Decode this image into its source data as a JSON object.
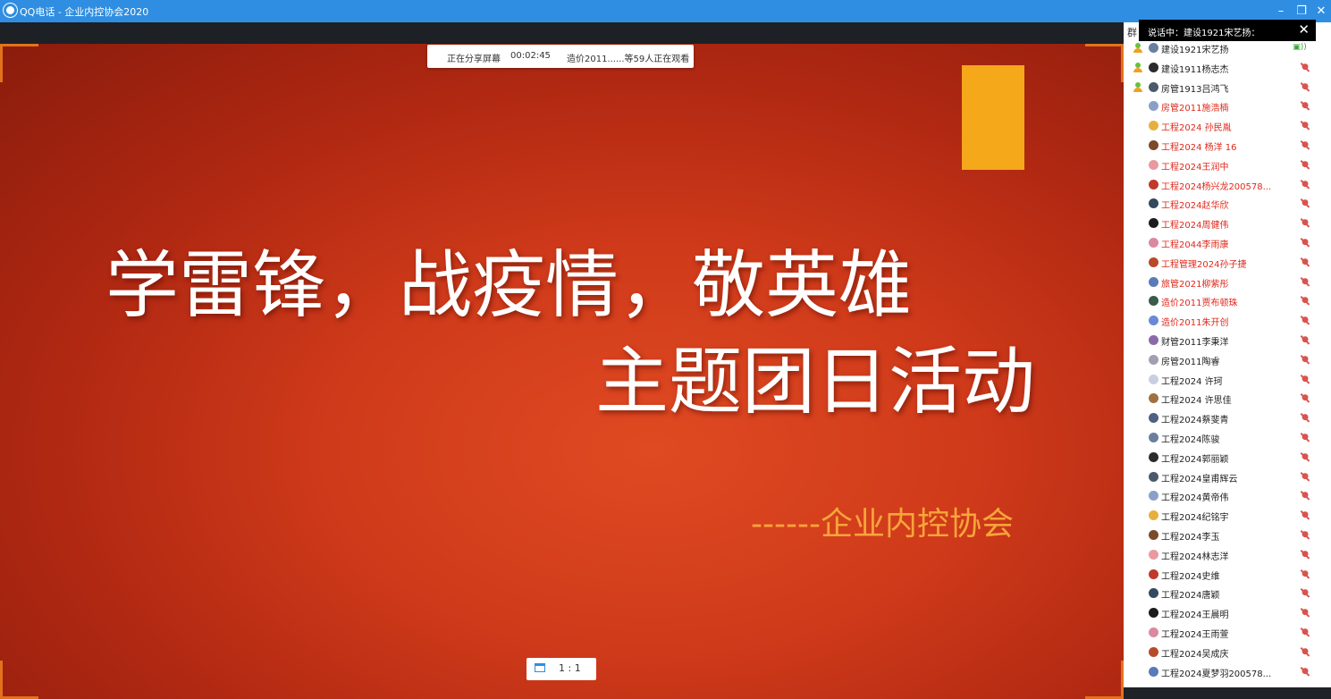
{
  "window": {
    "title": "QQ电话 - 企业内控协会2020",
    "buttons": {
      "minimize": "–",
      "restore": "❐",
      "close": "✕"
    }
  },
  "share_bar": {
    "status": "正在分享屏幕",
    "timer": "00:02:45",
    "viewers": "造价2011......等59人正在观看"
  },
  "slide": {
    "title_line1": "学雷锋，战疫情，敬英雄",
    "title_line2": "主题团日活动",
    "subtitle": "------企业内控协会",
    "colors": {
      "background": "#cf3a1a",
      "accent_bar": "#f4a81a",
      "subtitle": "#f8a53a"
    }
  },
  "ratio_button": {
    "label": "1 : 1"
  },
  "sidebar": {
    "tab_stub": "群",
    "speaking_tip": "说话中：建设1921宋艺扬：",
    "speaking_close": "✕",
    "members": [
      {
        "name": "建设1921宋艺扬",
        "host": true,
        "red": false,
        "speaking": true
      },
      {
        "name": "建设1911杨志杰",
        "host": true,
        "red": false
      },
      {
        "name": "房管1913吕鸿飞",
        "host": true,
        "red": false
      },
      {
        "name": "房管2011施浩楠",
        "host": false,
        "red": true
      },
      {
        "name": "工程2024 孙民胤",
        "host": false,
        "red": true
      },
      {
        "name": "工程2024 杨洋 16",
        "host": false,
        "red": true
      },
      {
        "name": "工程2024王润中",
        "host": false,
        "red": true
      },
      {
        "name": "工程2024杨兴龙200578...",
        "host": false,
        "red": true
      },
      {
        "name": "工程2024赵华欣",
        "host": false,
        "red": true
      },
      {
        "name": "工程2024周健伟",
        "host": false,
        "red": true
      },
      {
        "name": "工程2044李雨康",
        "host": false,
        "red": true
      },
      {
        "name": "工程管理2024孙子捷",
        "host": false,
        "red": true
      },
      {
        "name": "旅管2021柳紫彤",
        "host": false,
        "red": true
      },
      {
        "name": "造价2011贾布顿珠",
        "host": false,
        "red": true
      },
      {
        "name": "造价2011朱开创",
        "host": false,
        "red": true
      },
      {
        "name": "财管2011李秉洋",
        "host": false,
        "red": false
      },
      {
        "name": "房管2011陶睿",
        "host": false,
        "red": false
      },
      {
        "name": "工程2024 许珂",
        "host": false,
        "red": false
      },
      {
        "name": "工程2024 许思佳",
        "host": false,
        "red": false
      },
      {
        "name": "工程2024蔡斐青",
        "host": false,
        "red": false
      },
      {
        "name": "工程2024陈骏",
        "host": false,
        "red": false
      },
      {
        "name": "工程2024郭丽颖",
        "host": false,
        "red": false
      },
      {
        "name": "工程2024皇甫辉云",
        "host": false,
        "red": false
      },
      {
        "name": "工程2024黄帝伟",
        "host": false,
        "red": false
      },
      {
        "name": "工程2024纪铭宇",
        "host": false,
        "red": false
      },
      {
        "name": "工程2024李玉",
        "host": false,
        "red": false
      },
      {
        "name": "工程2024林志洋",
        "host": false,
        "red": false
      },
      {
        "name": "工程2024史维",
        "host": false,
        "red": false
      },
      {
        "name": "工程2024唐颖",
        "host": false,
        "red": false
      },
      {
        "name": "工程2024王晨明",
        "host": false,
        "red": false
      },
      {
        "name": "工程2024王雨萱",
        "host": false,
        "red": false
      },
      {
        "name": "工程2024吴成庆",
        "host": false,
        "red": false
      },
      {
        "name": "工程2024夏梦羽200578...",
        "host": false,
        "red": false
      }
    ]
  },
  "member_text_colors": {
    "red": "#e0291c",
    "normal": "#222222"
  },
  "avatar_colors": [
    "#6a7f9e",
    "#2b2b2b",
    "#4a5a6a",
    "#8aa0c8",
    "#e6b040",
    "#7a4a2a",
    "#e99aa0",
    "#c0392b",
    "#34495e",
    "#1b1b1b",
    "#d98aa0",
    "#b84a2a",
    "#5a7ab8",
    "#3a5a4a",
    "#6a8ad8",
    "#8a6aa8",
    "#a0a0b0",
    "#c8d0e0",
    "#a07040",
    "#506080"
  ]
}
